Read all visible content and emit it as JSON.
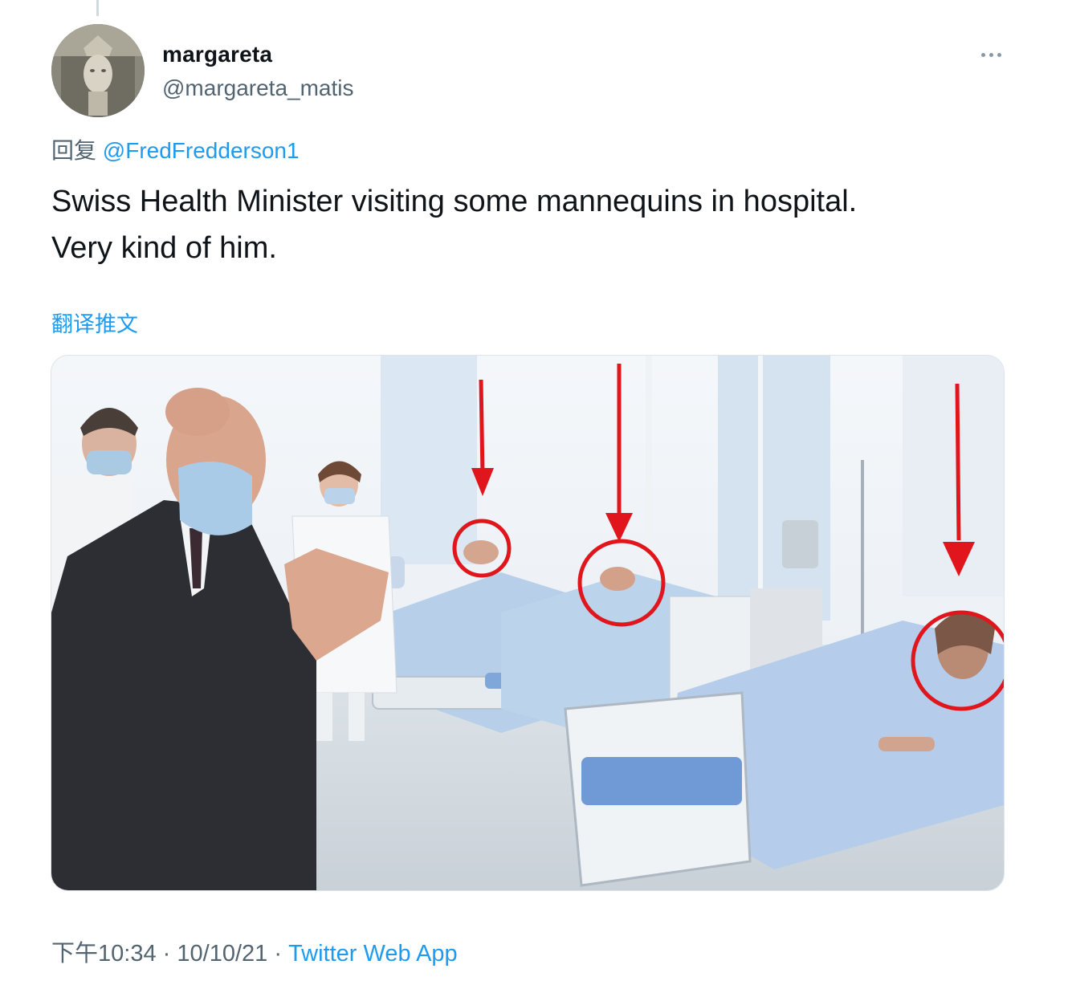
{
  "tweet": {
    "display_name": "margareta",
    "handle": "@margareta_matis",
    "more_label": "···",
    "reply_prefix": "回复",
    "reply_mention": "@FredFredderson1",
    "text": "Swiss Health Minister visiting some mannequins in hospital.\nVery kind of him.",
    "translate_label": "翻译推文",
    "time": "下午10:34",
    "separator": "·",
    "date": "10/10/21",
    "source": "Twitter Web App"
  },
  "colors": {
    "text": "#0f1419",
    "secondary": "#536471",
    "link": "#1d9bf0",
    "annotation_red": "#e0161c"
  },
  "icons": {
    "more": "more-horizontal-icon"
  }
}
